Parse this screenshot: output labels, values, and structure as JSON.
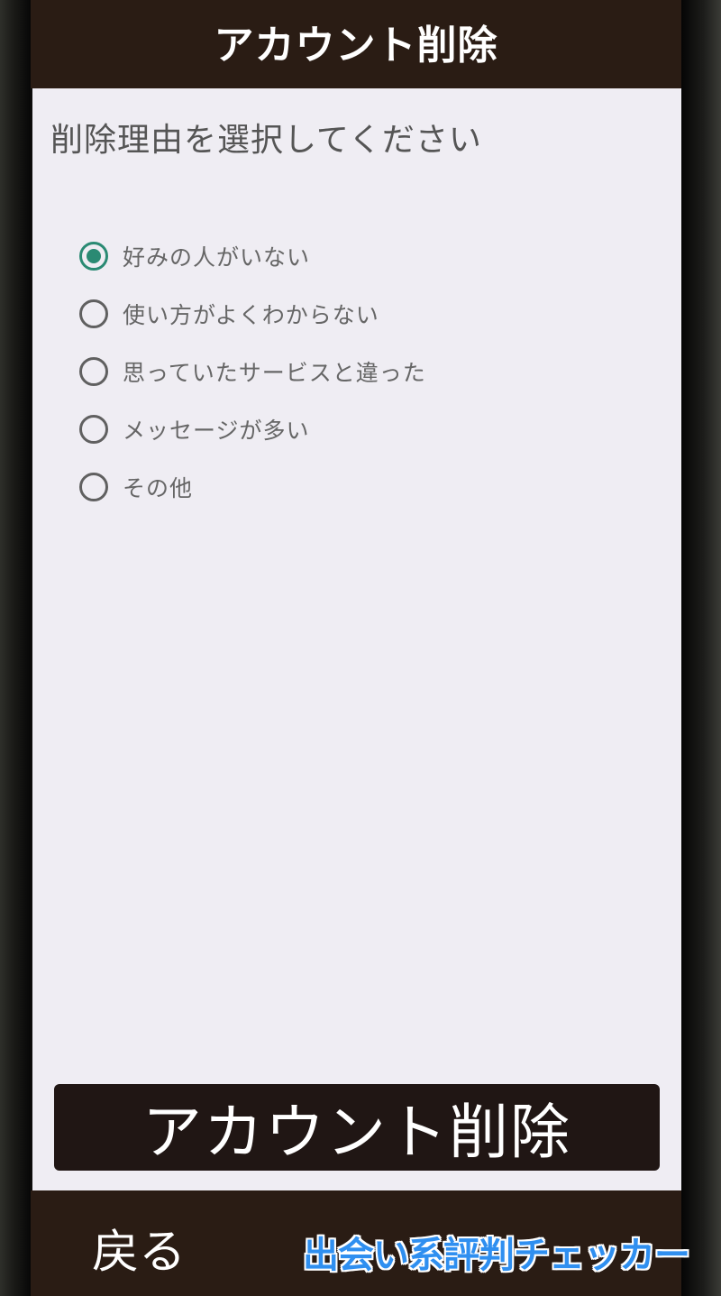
{
  "header": {
    "title": "アカウント削除"
  },
  "main": {
    "prompt": "削除理由を選択してください",
    "reasons": [
      {
        "label": "好みの人がいない",
        "checked": true
      },
      {
        "label": "使い方がよくわからない",
        "checked": false
      },
      {
        "label": "思っていたサービスと違った",
        "checked": false
      },
      {
        "label": "メッセージが多い",
        "checked": false
      },
      {
        "label": "その他",
        "checked": false
      }
    ],
    "delete_button_label": "アカウント削除"
  },
  "footer": {
    "back_label": "戻る"
  },
  "watermark": {
    "text": "出会い系評判チェッカー"
  },
  "colors": {
    "header_bg": "#2a1c14",
    "content_bg": "#efedf3",
    "radio_accent": "#2a8a73",
    "watermark": "#2f8ff0"
  }
}
